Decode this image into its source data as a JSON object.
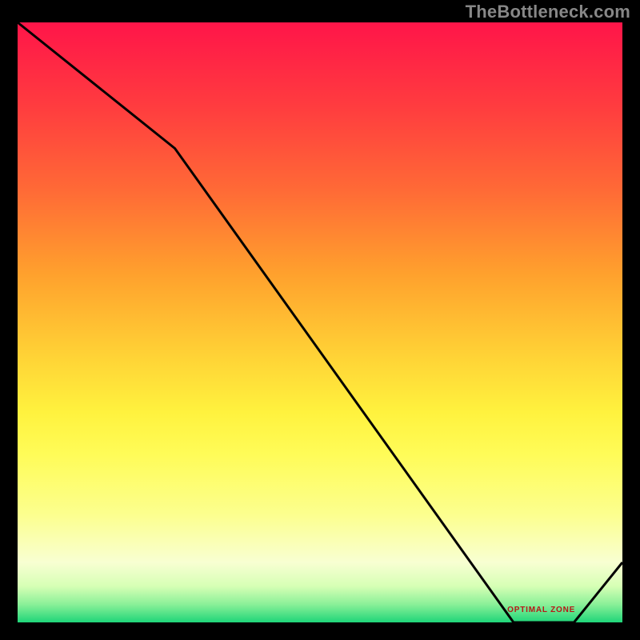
{
  "watermark": "TheBottleneck.com",
  "marker": {
    "label": "OPTIMAL ZONE"
  },
  "colors": {
    "watermark": "#878787",
    "marker_text": "#b71717",
    "line": "#000000"
  },
  "chart_data": {
    "type": "line",
    "title": "",
    "xlabel": "",
    "ylabel": "",
    "xlim": [
      0,
      100
    ],
    "ylim": [
      0,
      100
    ],
    "series": [
      {
        "name": "bottleneck-curve",
        "x": [
          0,
          26,
          82,
          86,
          92,
          100
        ],
        "y": [
          100,
          79,
          0,
          0,
          0,
          10
        ]
      }
    ],
    "annotations": [
      {
        "text": "OPTIMAL ZONE",
        "x": 86,
        "y": 2
      }
    ],
    "gradient_stops": [
      "#ff1549",
      "#ff3c3f",
      "#ff6a36",
      "#ffa12d",
      "#ffd436",
      "#fff23e",
      "#fffc58",
      "#fcff8e",
      "#f8ffd2",
      "#d6ffb5",
      "#8af098",
      "#1fd579"
    ]
  }
}
